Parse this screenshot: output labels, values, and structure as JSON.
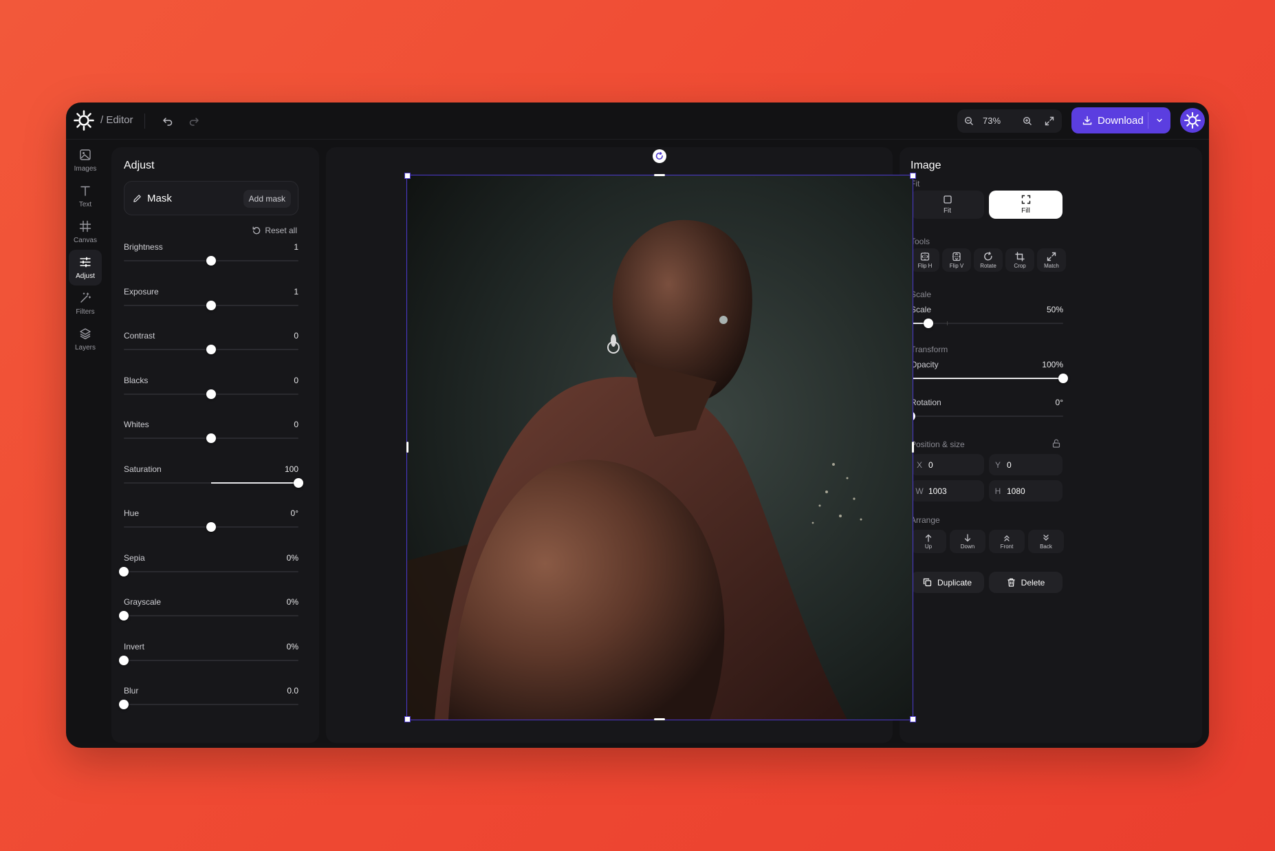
{
  "topbar": {
    "breadcrumb": "/ Editor",
    "zoom": "73%",
    "download_label": "Download"
  },
  "rail": [
    {
      "label": "Images",
      "icon": "image-icon"
    },
    {
      "label": "Text",
      "icon": "text-icon"
    },
    {
      "label": "Canvas",
      "icon": "canvas-grid-icon"
    },
    {
      "label": "Adjust",
      "icon": "sliders-icon",
      "active": true
    },
    {
      "label": "Filters",
      "icon": "magic-wand-icon"
    },
    {
      "label": "Layers",
      "icon": "layers-icon"
    }
  ],
  "adjust": {
    "title": "Adjust",
    "mask_label": "Mask",
    "add_mask": "Add mask",
    "reset_all": "Reset all",
    "sliders": [
      {
        "name": "Brightness",
        "value": "1",
        "level": 0.5
      },
      {
        "name": "Exposure",
        "value": "1",
        "level": 0.5
      },
      {
        "name": "Contrast",
        "value": "0",
        "level": 0.5
      },
      {
        "name": "Blacks",
        "value": "0",
        "level": 0.5
      },
      {
        "name": "Whites",
        "value": "0",
        "level": 0.5
      },
      {
        "name": "Saturation",
        "value": "100",
        "level": 1.0,
        "fill_from": 0.5
      },
      {
        "name": "Hue",
        "value": "0°",
        "level": 0.5
      },
      {
        "name": "Sepia",
        "value": "0%",
        "level": 0
      },
      {
        "name": "Grayscale",
        "value": "0%",
        "level": 0
      },
      {
        "name": "Invert",
        "value": "0%",
        "level": 0
      },
      {
        "name": "Blur",
        "value": "0.0",
        "level": 0
      }
    ]
  },
  "image_panel": {
    "title": "Image",
    "fit_heading": "Fit",
    "fit_options": [
      {
        "label": "Fit",
        "icon": "square-icon"
      },
      {
        "label": "Fill",
        "icon": "expand-corners-icon",
        "selected": true
      }
    ],
    "tools_heading": "Tools",
    "tools": [
      {
        "label": "Flip H",
        "icon": "flip-horizontal-icon"
      },
      {
        "label": "Flip V",
        "icon": "flip-vertical-icon"
      },
      {
        "label": "Rotate",
        "icon": "rotate-icon"
      },
      {
        "label": "Crop",
        "icon": "crop-icon"
      },
      {
        "label": "Match",
        "icon": "expand-diagonal-icon"
      }
    ],
    "scale_heading": "Scale",
    "scale_label": "Scale",
    "scale_value": "50%",
    "scale_level": 0.115,
    "transform_heading": "Transform",
    "opacity_label": "Opacity",
    "opacity_value": "100%",
    "opacity_level": 1.0,
    "rotation_label": "Rotation",
    "rotation_value": "0°",
    "rotation_level": 0,
    "position_heading": "Position & size",
    "x_label": "X",
    "x_value": "0",
    "y_label": "Y",
    "y_value": "0",
    "w_label": "W",
    "w_value": "1003",
    "h_label": "H",
    "h_value": "1080",
    "arrange_heading": "Arrange",
    "arrange": [
      {
        "label": "Up",
        "icon": "arrow-up-icon"
      },
      {
        "label": "Down",
        "icon": "arrow-down-icon"
      },
      {
        "label": "Front",
        "icon": "double-chevron-up-icon"
      },
      {
        "label": "Back",
        "icon": "double-chevron-down-icon"
      }
    ],
    "duplicate_label": "Duplicate",
    "delete_label": "Delete"
  },
  "colors": {
    "accent": "#5b3ee0",
    "background": "#ef4a33",
    "surface": "#17171a"
  }
}
